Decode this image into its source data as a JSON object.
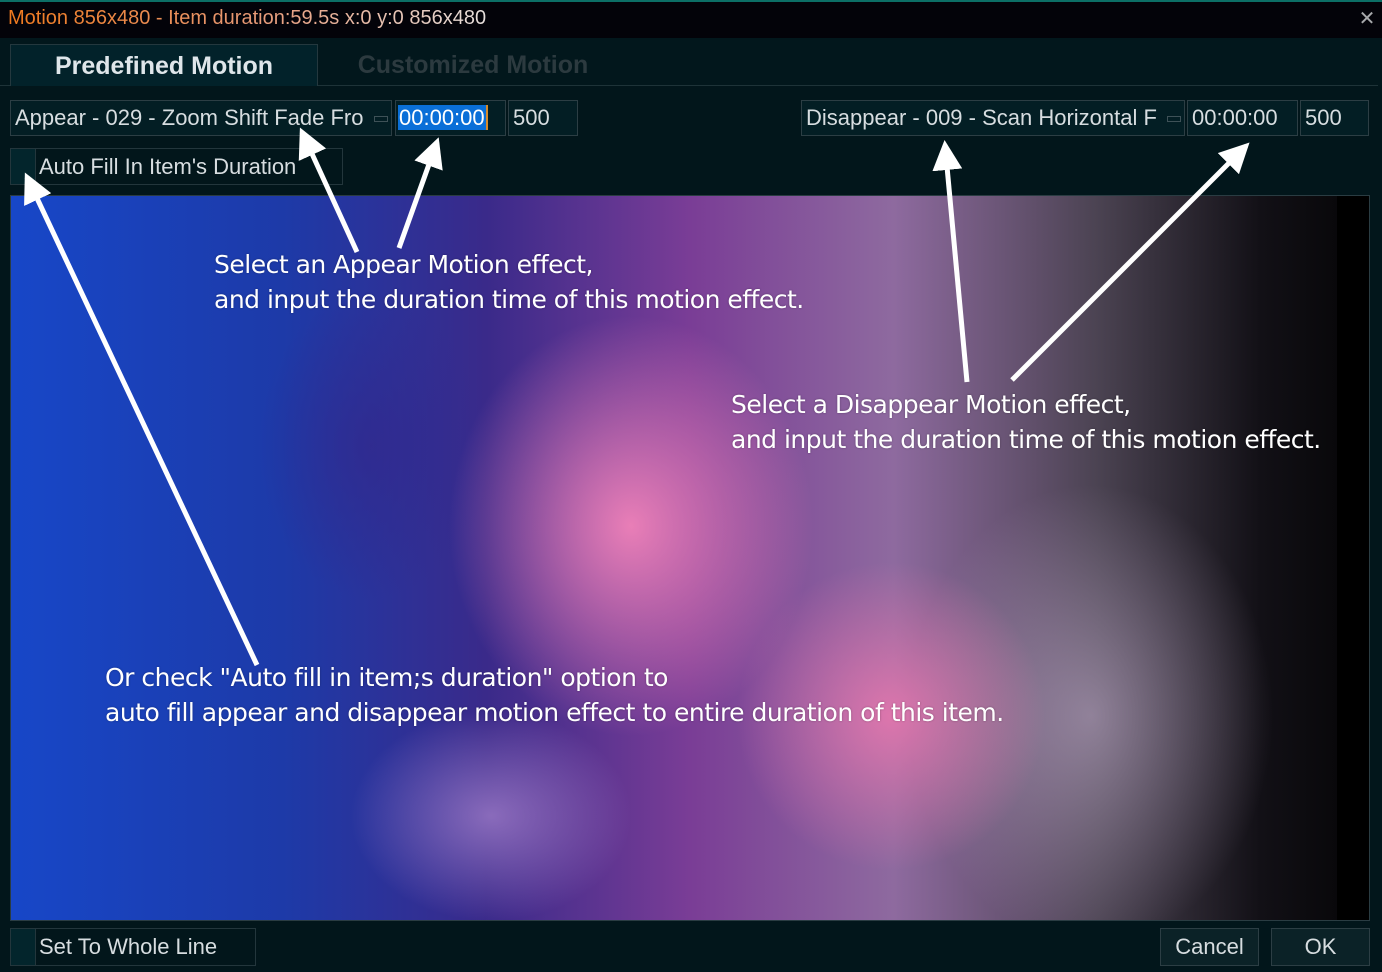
{
  "window": {
    "title": "Motion 856x480 - Item duration:59.5s x:0 y:0 856x480",
    "close_icon": "close-icon"
  },
  "tabs": [
    {
      "label": "Predefined Motion",
      "active": true
    },
    {
      "label": "Customized Motion",
      "active": false
    }
  ],
  "appear": {
    "effect": "Appear - 029 - Zoom Shift Fade Fro",
    "time": "00:00:00",
    "duration": "500"
  },
  "disappear": {
    "effect": "Disappear - 009 - Scan Horizontal F",
    "time": "00:00:00",
    "duration": "500"
  },
  "auto_fill": {
    "label": "Auto Fill In Item's Duration",
    "checked": false
  },
  "annotations": {
    "appear_line1": "Select an Appear Motion effect,",
    "appear_line2": "and input the duration time of this motion effect.",
    "disappear_line1": "Select a Disappear Motion effect,",
    "disappear_line2": "and input the duration time of this motion effect.",
    "autofill_line1": "Or check \"Auto fill in item;s duration\" option to",
    "autofill_line2": "auto fill appear and disappear motion effect to entire duration of this item."
  },
  "footer": {
    "set_whole_line": "Set To Whole Line",
    "cancel": "Cancel",
    "ok": "OK"
  },
  "colors": {
    "title_accent": "#f07a1e",
    "selection": "#0a6fd8",
    "background": "#02161b"
  }
}
